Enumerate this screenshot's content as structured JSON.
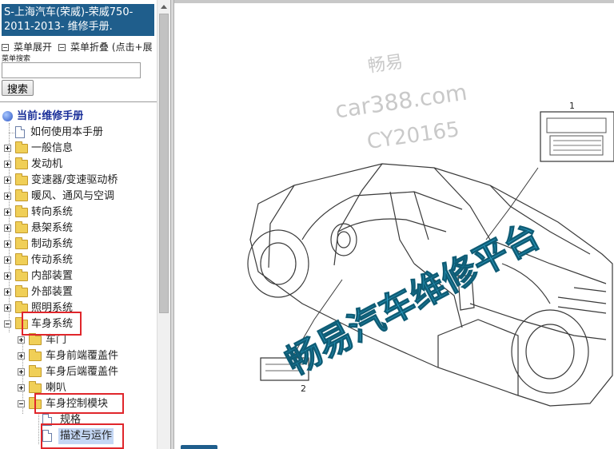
{
  "nav": {
    "title": "S-上海汽车(荣威)-荣威750-2011-2013- 维修手册.",
    "menu_expand": "菜单展开",
    "menu_collapse": "菜单折叠 (点击+展",
    "search_label": "菜单搜索",
    "search_value": "",
    "search_button": "搜索"
  },
  "tree": {
    "current": "当前:维修手册",
    "items": [
      "如何使用本手册",
      "一般信息",
      "发动机",
      "变速器/变速驱动桥",
      "暖风、通风与空调",
      "转向系统",
      "悬架系统",
      "制动系统",
      "传动系统",
      "内部装置",
      "外部装置",
      "照明系统",
      "车身系统"
    ],
    "body_children": [
      "车门",
      "车身前端覆盖件",
      "车身后端覆盖件",
      "喇叭",
      "车身控制模块"
    ],
    "bcm_children": [
      "规格",
      "描述与运作"
    ]
  },
  "diagram": {
    "watermark_lines": [
      "畅易",
      "car388.com",
      "CY20165"
    ],
    "overlay_text": "畅易汽车维修平台",
    "callouts": [
      "1",
      "2"
    ]
  }
}
